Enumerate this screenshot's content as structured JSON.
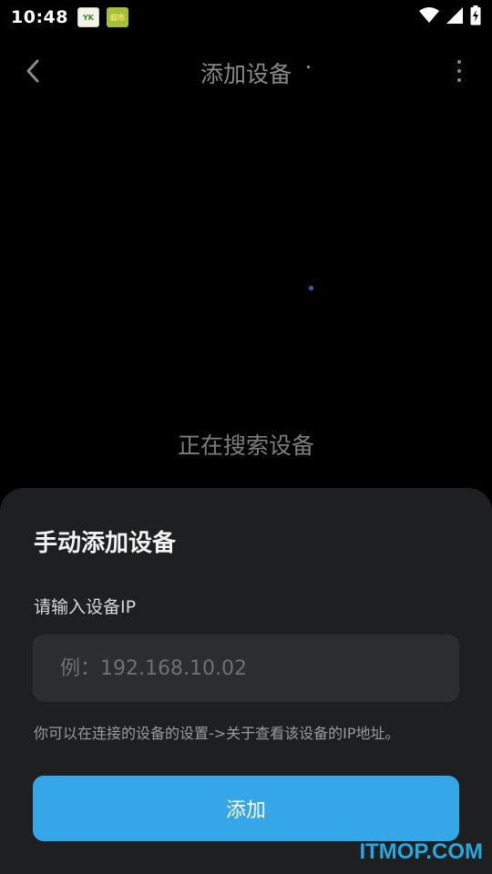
{
  "status_bar": {
    "time": "10:48",
    "notifications": [
      {
        "icon": "yk-app-icon",
        "text": "YK"
      },
      {
        "icon": "market-app-icon",
        "text": "超市"
      }
    ],
    "icons": [
      "wifi-icon",
      "signal-icon",
      "battery-charging-icon"
    ]
  },
  "header": {
    "title": "添加设备",
    "back_icon": "chevron-left-icon",
    "more_icon": "more-vertical-icon"
  },
  "search": {
    "status_text": "正在搜索设备"
  },
  "sheet": {
    "title": "手动添加设备",
    "field_label": "请输入设备IP",
    "ip_placeholder": "例：192.168.10.02",
    "ip_value": "",
    "hint": "你可以在连接的设备的设置->关于查看该设备的IP地址。",
    "add_button": "添加"
  },
  "watermark": "ITMOP.COM",
  "colors": {
    "accent": "#35a6e8",
    "sheet_bg": "#1e1f21",
    "input_bg": "#2c2d30",
    "background": "#000000"
  }
}
